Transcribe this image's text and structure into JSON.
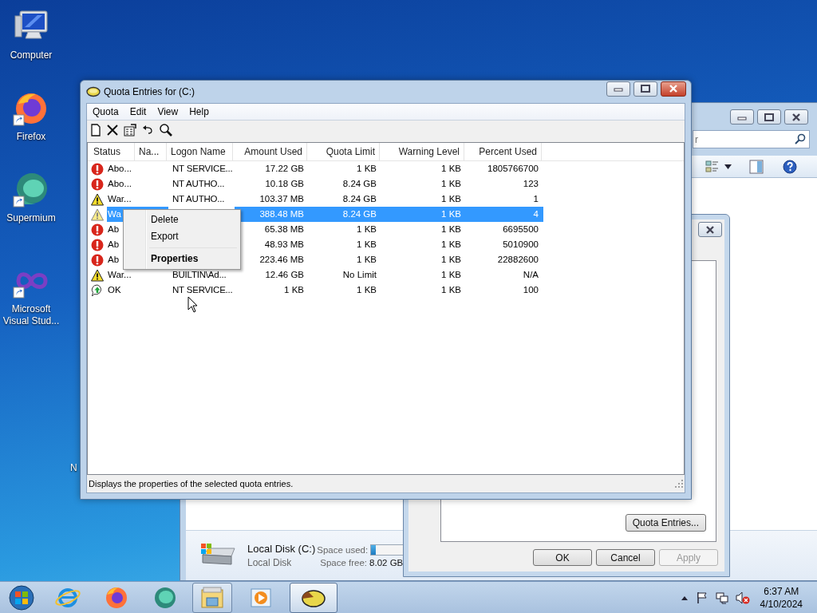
{
  "desktop": {
    "icons": [
      {
        "label": "Computer",
        "kind": "computer",
        "shortcut": false
      },
      {
        "label": "Firefox",
        "kind": "firefox",
        "shortcut": true
      },
      {
        "label": "Supermium",
        "kind": "supermium",
        "shortcut": true
      },
      {
        "label": "Microsoft Visual Stud...",
        "kind": "visualstudio",
        "shortcut": true
      }
    ],
    "hidden_label": "N"
  },
  "explorer_window": {
    "search": {
      "placeholder": "r"
    },
    "details": {
      "name": "Local Disk (C:)",
      "type": "Local Disk",
      "used_label": "Space used:",
      "level": 0.04,
      "free_label": "Space free:",
      "free_value": "8.02 GB"
    }
  },
  "properties_dialog": {
    "quota_button": "Quota Entries...",
    "buttons": [
      {
        "label": "OK",
        "disabled": false
      },
      {
        "label": "Cancel",
        "disabled": false
      },
      {
        "label": "Apply",
        "disabled": true
      }
    ]
  },
  "quota_window": {
    "title": "Quota Entries for  (C:)",
    "menu": [
      "Quota",
      "Edit",
      "View",
      "Help"
    ],
    "columns": [
      "Status",
      "Na...",
      "Logon Name",
      "Amount Used",
      "Quota Limit",
      "Warning Level",
      "Percent Used"
    ],
    "rows": [
      {
        "kind": "error",
        "status": "Abo...",
        "logon": "NT SERVICE...",
        "amount_used": "17.22 GB",
        "quota_limit": "1 KB",
        "warning_level": "1 KB",
        "percent_used": "1805766700",
        "selected": false
      },
      {
        "kind": "error",
        "status": "Abo...",
        "logon": "NT AUTHO...",
        "amount_used": "10.18 GB",
        "quota_limit": "8.24 GB",
        "warning_level": "1 KB",
        "percent_used": "123",
        "selected": false
      },
      {
        "kind": "warning",
        "status": "War...",
        "logon": "NT AUTHO...",
        "amount_used": "103.37 MB",
        "quota_limit": "8.24 GB",
        "warning_level": "1 KB",
        "percent_used": "1",
        "selected": false
      },
      {
        "kind": "warning",
        "status": "Wa",
        "amount_used": "388.48 MB",
        "quota_limit": "8.24 GB",
        "warning_level": "1 KB",
        "percent_used": "4",
        "selected": true
      },
      {
        "kind": "error",
        "status": "Ab",
        "amount_used": "65.38 MB",
        "quota_limit": "1 KB",
        "warning_level": "1 KB",
        "percent_used": "6695500",
        "selected": false
      },
      {
        "kind": "error",
        "status": "Ab",
        "amount_used": "48.93 MB",
        "quota_limit": "1 KB",
        "warning_level": "1 KB",
        "percent_used": "5010900",
        "selected": false
      },
      {
        "kind": "error",
        "status": "Ab",
        "amount_used": "223.46 MB",
        "quota_limit": "1 KB",
        "warning_level": "1 KB",
        "percent_used": "22882600",
        "selected": false
      },
      {
        "kind": "warning",
        "status": "War...",
        "logon": "BUILTIN\\Ad...",
        "amount_used": "12.46 GB",
        "quota_limit": "No Limit",
        "warning_level": "1 KB",
        "percent_used": "N/A",
        "selected": false
      },
      {
        "kind": "ok",
        "status": "OK",
        "logon": "NT SERVICE...",
        "amount_used": "1 KB",
        "quota_limit": "1 KB",
        "warning_level": "1 KB",
        "percent_used": "100",
        "selected": false
      }
    ],
    "context_menu": [
      {
        "kind": "item",
        "label": "Delete",
        "default": false
      },
      {
        "kind": "item",
        "label": "Export",
        "default": false
      },
      {
        "kind": "separator"
      },
      {
        "kind": "item",
        "label": "Properties",
        "default": true
      }
    ],
    "status_bar": "Displays the properties of the selected quota entries."
  },
  "taskbar": {
    "buttons": [
      {
        "kind": "start",
        "running": false,
        "selected": false
      },
      {
        "kind": "ie",
        "running": false,
        "selected": false
      },
      {
        "kind": "firefox",
        "running": false,
        "selected": false
      },
      {
        "kind": "supermium",
        "running": false,
        "selected": false
      },
      {
        "kind": "explorer",
        "running": true,
        "selected": false
      },
      {
        "kind": "media",
        "running": false,
        "selected": false
      },
      {
        "kind": "quota",
        "running": true,
        "selected": true
      }
    ],
    "clock": {
      "time": "6:37 AM",
      "date": "4/10/2024"
    }
  }
}
